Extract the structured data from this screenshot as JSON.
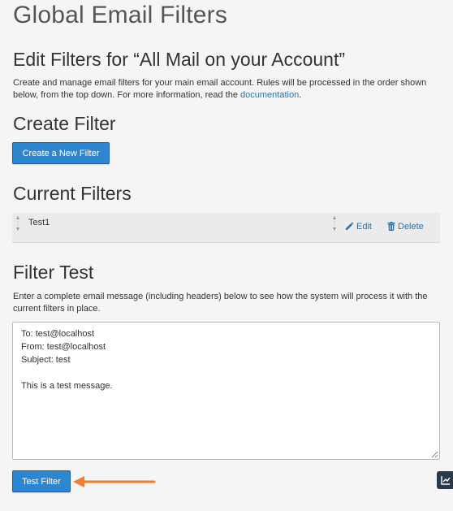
{
  "page": {
    "title": "Global Email Filters"
  },
  "edit_section": {
    "heading": "Edit Filters for “All Mail on your Account”",
    "description_pre": "Create and manage email filters for your main email account. Rules will be processed in the order shown below, from the top down. For more information, read the ",
    "doc_link": "documentation",
    "description_post": "."
  },
  "create_section": {
    "heading": "Create Filter",
    "create_button": "Create a New Filter"
  },
  "current_section": {
    "heading": "Current Filters",
    "filters": [
      {
        "name": "Test1",
        "edit_label": "Edit",
        "delete_label": "Delete"
      }
    ]
  },
  "test_section": {
    "heading": "Filter Test",
    "description": "Enter a complete email message (including headers) below to see how the system will process it with the current filters in place.",
    "message": "To: test@localhost\nFrom: test@localhost\nSubject: test\n\nThis is a test message.",
    "test_button": "Test Filter"
  },
  "colors": {
    "primary_button": "#2f86d0",
    "link": "#2a73a9",
    "annotation_arrow": "#f07c2e",
    "chart_button_bg": "#293a4a"
  },
  "icons": {
    "edit": "pencil-icon",
    "delete": "trash-icon",
    "drag": "drag-handle-icon",
    "stats": "chart-icon"
  }
}
